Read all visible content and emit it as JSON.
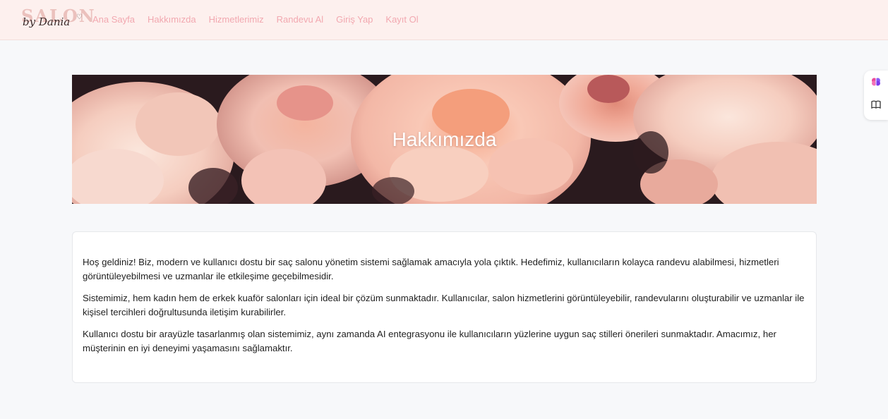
{
  "navbar": {
    "brand_big": "SALON",
    "brand_script": "by Dania",
    "brand_heart": "♡",
    "links": [
      {
        "label": "Ana Sayfa"
      },
      {
        "label": "Hakkımızda"
      },
      {
        "label": "Hizmetlerimiz"
      },
      {
        "label": "Randevu Al"
      },
      {
        "label": "Giriş Yap"
      },
      {
        "label": "Kayıt Ol"
      }
    ]
  },
  "hero": {
    "title": "Hakkımızda"
  },
  "about": {
    "paragraphs": [
      "Hoş geldiniz! Biz, modern ve kullanıcı dostu bir saç salonu yönetim sistemi sağlamak amacıyla yola çıktık. Hedefimiz, kullanıcıların kolayca randevu alabilmesi, hizmetleri görüntüleyebilmesi ve uzmanlar ile etkileşime geçebilmesidir.",
      "Sistemimiz, hem kadın hem de erkek kuaför salonları için ideal bir çözüm sunmaktadır. Kullanıcılar, salon hizmetlerini görüntüleyebilir, randevularını oluşturabilir ve uzmanlar ile kişisel tercihleri doğrultusunda iletişim kurabilirler.",
      "Kullanıcı dostu bir arayüzle tasarlanmış olan sistemimiz, aynı zamanda AI entegrasyonu ile kullanıcıların yüzlerine uygun saç stilleri önerileri sunmaktadır. Amacımız, her müşterinin en iyi deneyimi yaşamasını sağlamaktır."
    ]
  },
  "float_tools": {
    "items": [
      {
        "icon": "brain-icon"
      },
      {
        "icon": "book-icon"
      }
    ]
  },
  "colors": {
    "navbar_bg": "#fdf0ee",
    "nav_link": "#f2a8b0",
    "page_bg": "#f7f8fa",
    "peony": "#f6c3b3"
  }
}
